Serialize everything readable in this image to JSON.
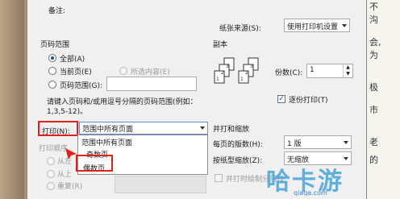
{
  "header": {
    "remarks_label": "备注:",
    "paper_source_label": "纸张来源(S):",
    "paper_source_value": "使用打印机设置"
  },
  "page_range": {
    "title": "页码范围",
    "all": "全部(A)",
    "current": "当前页(E)",
    "selection": "所选内容(E)",
    "pages": "页码范围(G):",
    "hint_line1": "请键入页码和/或用逗号分隔的页码范围(例如：",
    "hint_line2": "1,3,5-12)。"
  },
  "print": {
    "label": "打印(N):",
    "selected": "范围中所有页面",
    "options": [
      "范围中所有页面",
      "奇数页",
      "偶数页"
    ]
  },
  "order": {
    "title": "打印顺序",
    "from_left": "从左",
    "from_top": "从上",
    "repeat": "重复(R)"
  },
  "copies": {
    "title": "副本",
    "count_label": "份数(C):",
    "count_value": "1",
    "collate": "逐份打印(T)"
  },
  "zoom": {
    "title": "并打和缩放",
    "pages_per_sheet_label": "每页的版数(H):",
    "pages_per_sheet_value": "1 版",
    "scale_label": "按纸型缩放(Z):",
    "scale_value": "无缩放",
    "bind_print": "并打时绘制分隔线"
  },
  "background_text": {
    "lines": [
      "不",
      "沟",
      "会,",
      "为",
      "极",
      "市",
      "老",
      "的"
    ]
  },
  "watermark": {
    "brand": "哈卡游",
    "url": "qiaqa.com"
  }
}
